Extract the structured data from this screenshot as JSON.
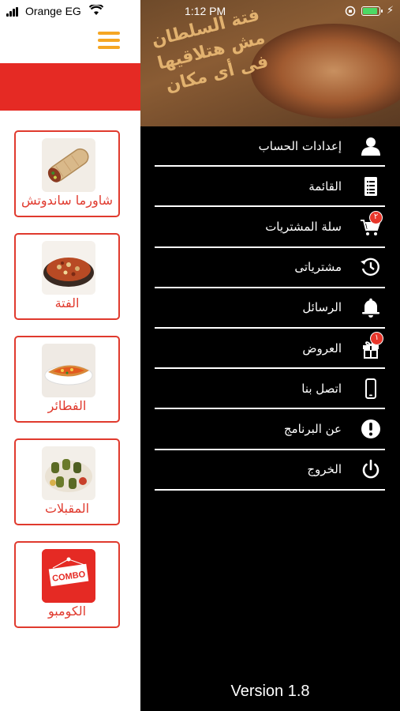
{
  "status_bar": {
    "carrier": "Orange EG",
    "time": "1:12 PM",
    "battery_color": "#4cd964"
  },
  "categories": [
    {
      "label": "شاورما ساندوتش",
      "image": "shawarma-sandwich-image"
    },
    {
      "label": "الفتة",
      "image": "fatta-dish-image"
    },
    {
      "label": "الفطائر",
      "image": "pie-image"
    },
    {
      "label": "المقبلات",
      "image": "appetizers-image"
    },
    {
      "label": "الكومبو",
      "image": "combo-image"
    }
  ],
  "combo_badge_text": "COMBO",
  "banner": {
    "text_line1": "فتة السلطان",
    "text_line2": "مش هتلاقيها",
    "text_line3": "فى أى مكان"
  },
  "menu": [
    {
      "label": "إعدادات الحساب",
      "icon": "account-icon"
    },
    {
      "label": "القائمة",
      "icon": "menu-list-icon"
    },
    {
      "label": "سلة المشتريات",
      "icon": "cart-icon",
      "badge": "٢"
    },
    {
      "label": "مشترياتى",
      "icon": "history-icon"
    },
    {
      "label": "الرسائل",
      "icon": "bell-icon"
    },
    {
      "label": "العروض",
      "icon": "gift-icon",
      "badge": "١"
    },
    {
      "label": "اتصل بنا",
      "icon": "phone-icon"
    },
    {
      "label": "عن البرنامج",
      "icon": "info-icon"
    },
    {
      "label": "الخروج",
      "icon": "power-icon"
    }
  ],
  "version": "Version 1.8",
  "colors": {
    "accent_red": "#e03a2e",
    "accent_orange": "#f5a623",
    "header_red": "#e52a24",
    "drawer_bg": "#000000"
  }
}
